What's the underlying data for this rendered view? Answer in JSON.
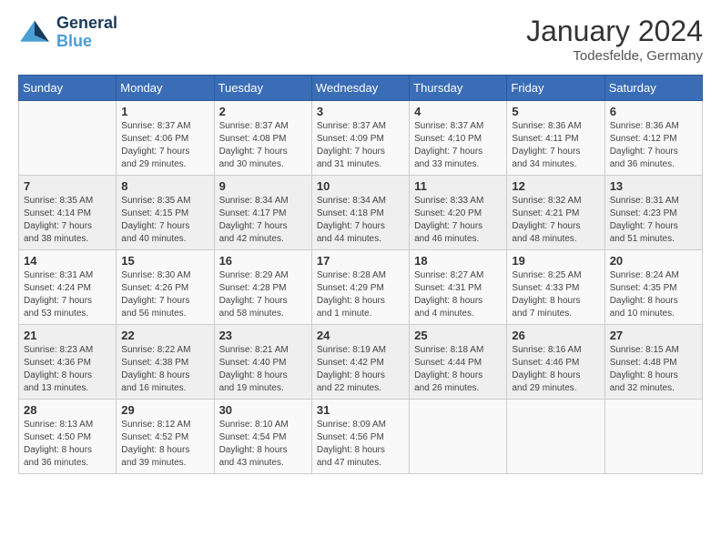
{
  "header": {
    "logo_line1": "General",
    "logo_line2": "Blue",
    "month_title": "January 2024",
    "location": "Todesfelde, Germany"
  },
  "weekdays": [
    "Sunday",
    "Monday",
    "Tuesday",
    "Wednesday",
    "Thursday",
    "Friday",
    "Saturday"
  ],
  "weeks": [
    [
      {
        "day": "",
        "info": ""
      },
      {
        "day": "1",
        "info": "Sunrise: 8:37 AM\nSunset: 4:06 PM\nDaylight: 7 hours\nand 29 minutes."
      },
      {
        "day": "2",
        "info": "Sunrise: 8:37 AM\nSunset: 4:08 PM\nDaylight: 7 hours\nand 30 minutes."
      },
      {
        "day": "3",
        "info": "Sunrise: 8:37 AM\nSunset: 4:09 PM\nDaylight: 7 hours\nand 31 minutes."
      },
      {
        "day": "4",
        "info": "Sunrise: 8:37 AM\nSunset: 4:10 PM\nDaylight: 7 hours\nand 33 minutes."
      },
      {
        "day": "5",
        "info": "Sunrise: 8:36 AM\nSunset: 4:11 PM\nDaylight: 7 hours\nand 34 minutes."
      },
      {
        "day": "6",
        "info": "Sunrise: 8:36 AM\nSunset: 4:12 PM\nDaylight: 7 hours\nand 36 minutes."
      }
    ],
    [
      {
        "day": "7",
        "info": "Sunrise: 8:35 AM\nSunset: 4:14 PM\nDaylight: 7 hours\nand 38 minutes."
      },
      {
        "day": "8",
        "info": "Sunrise: 8:35 AM\nSunset: 4:15 PM\nDaylight: 7 hours\nand 40 minutes."
      },
      {
        "day": "9",
        "info": "Sunrise: 8:34 AM\nSunset: 4:17 PM\nDaylight: 7 hours\nand 42 minutes."
      },
      {
        "day": "10",
        "info": "Sunrise: 8:34 AM\nSunset: 4:18 PM\nDaylight: 7 hours\nand 44 minutes."
      },
      {
        "day": "11",
        "info": "Sunrise: 8:33 AM\nSunset: 4:20 PM\nDaylight: 7 hours\nand 46 minutes."
      },
      {
        "day": "12",
        "info": "Sunrise: 8:32 AM\nSunset: 4:21 PM\nDaylight: 7 hours\nand 48 minutes."
      },
      {
        "day": "13",
        "info": "Sunrise: 8:31 AM\nSunset: 4:23 PM\nDaylight: 7 hours\nand 51 minutes."
      }
    ],
    [
      {
        "day": "14",
        "info": "Sunrise: 8:31 AM\nSunset: 4:24 PM\nDaylight: 7 hours\nand 53 minutes."
      },
      {
        "day": "15",
        "info": "Sunrise: 8:30 AM\nSunset: 4:26 PM\nDaylight: 7 hours\nand 56 minutes."
      },
      {
        "day": "16",
        "info": "Sunrise: 8:29 AM\nSunset: 4:28 PM\nDaylight: 7 hours\nand 58 minutes."
      },
      {
        "day": "17",
        "info": "Sunrise: 8:28 AM\nSunset: 4:29 PM\nDaylight: 8 hours\nand 1 minute."
      },
      {
        "day": "18",
        "info": "Sunrise: 8:27 AM\nSunset: 4:31 PM\nDaylight: 8 hours\nand 4 minutes."
      },
      {
        "day": "19",
        "info": "Sunrise: 8:25 AM\nSunset: 4:33 PM\nDaylight: 8 hours\nand 7 minutes."
      },
      {
        "day": "20",
        "info": "Sunrise: 8:24 AM\nSunset: 4:35 PM\nDaylight: 8 hours\nand 10 minutes."
      }
    ],
    [
      {
        "day": "21",
        "info": "Sunrise: 8:23 AM\nSunset: 4:36 PM\nDaylight: 8 hours\nand 13 minutes."
      },
      {
        "day": "22",
        "info": "Sunrise: 8:22 AM\nSunset: 4:38 PM\nDaylight: 8 hours\nand 16 minutes."
      },
      {
        "day": "23",
        "info": "Sunrise: 8:21 AM\nSunset: 4:40 PM\nDaylight: 8 hours\nand 19 minutes."
      },
      {
        "day": "24",
        "info": "Sunrise: 8:19 AM\nSunset: 4:42 PM\nDaylight: 8 hours\nand 22 minutes."
      },
      {
        "day": "25",
        "info": "Sunrise: 8:18 AM\nSunset: 4:44 PM\nDaylight: 8 hours\nand 26 minutes."
      },
      {
        "day": "26",
        "info": "Sunrise: 8:16 AM\nSunset: 4:46 PM\nDaylight: 8 hours\nand 29 minutes."
      },
      {
        "day": "27",
        "info": "Sunrise: 8:15 AM\nSunset: 4:48 PM\nDaylight: 8 hours\nand 32 minutes."
      }
    ],
    [
      {
        "day": "28",
        "info": "Sunrise: 8:13 AM\nSunset: 4:50 PM\nDaylight: 8 hours\nand 36 minutes."
      },
      {
        "day": "29",
        "info": "Sunrise: 8:12 AM\nSunset: 4:52 PM\nDaylight: 8 hours\nand 39 minutes."
      },
      {
        "day": "30",
        "info": "Sunrise: 8:10 AM\nSunset: 4:54 PM\nDaylight: 8 hours\nand 43 minutes."
      },
      {
        "day": "31",
        "info": "Sunrise: 8:09 AM\nSunset: 4:56 PM\nDaylight: 8 hours\nand 47 minutes."
      },
      {
        "day": "",
        "info": ""
      },
      {
        "day": "",
        "info": ""
      },
      {
        "day": "",
        "info": ""
      }
    ]
  ]
}
